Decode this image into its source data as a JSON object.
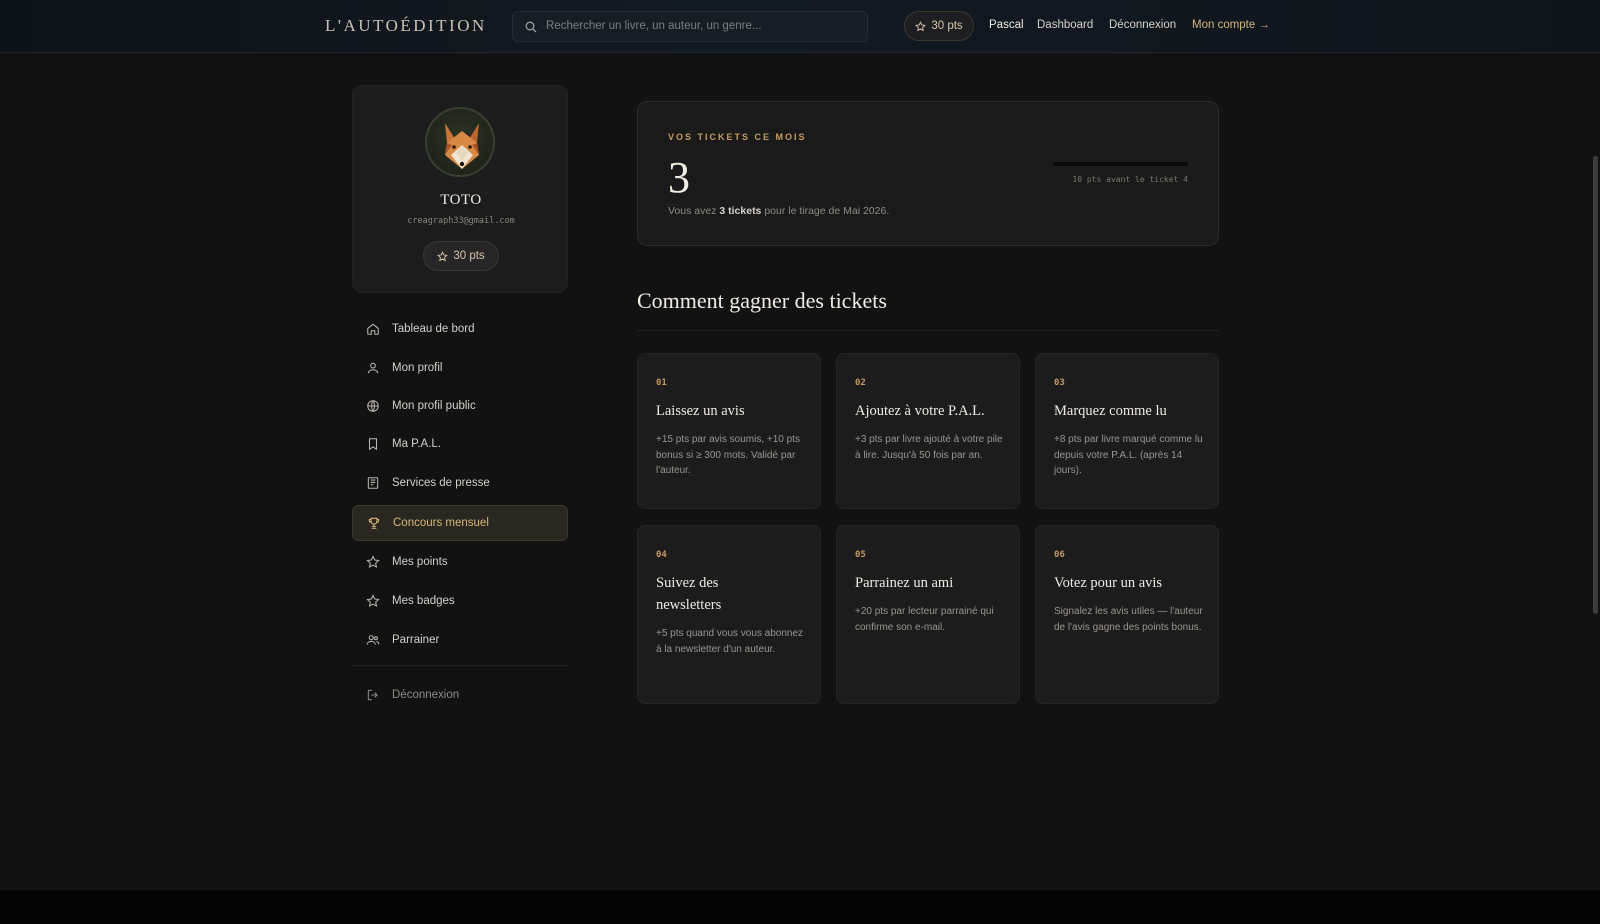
{
  "header": {
    "logo": "L'AUTOÉDITION",
    "search_placeholder": "Rechercher un livre, un auteur, un genre...",
    "points": "30 pts",
    "user": "Pascal",
    "dashboard": "Dashboard",
    "logout": "Déconnexion",
    "account": "Mon compte →"
  },
  "profile": {
    "name": "TOTO",
    "email": "creagraph33@gmail.com",
    "points": "30 pts"
  },
  "sidebar": {
    "items": [
      {
        "label": "Tableau de bord",
        "icon": "home-icon"
      },
      {
        "label": "Mon profil",
        "icon": "user-icon"
      },
      {
        "label": "Mon profil public",
        "icon": "globe-icon"
      },
      {
        "label": "Ma P.A.L.",
        "icon": "bookmark-icon"
      },
      {
        "label": "Services de presse",
        "icon": "newspaper-icon"
      },
      {
        "label": "Concours mensuel",
        "icon": "trophy-icon",
        "active": true
      },
      {
        "label": "Mes points",
        "icon": "star-icon"
      },
      {
        "label": "Mes badges",
        "icon": "star-icon"
      },
      {
        "label": "Parrainer",
        "icon": "users-icon"
      }
    ],
    "logout": "Déconnexion"
  },
  "tickets": {
    "label": "VOS TICKETS CE MOIS",
    "count": "3",
    "desc_prefix": "Vous avez ",
    "desc_bold": "3 tickets",
    "desc_suffix": " pour le tirage de Mai 2026.",
    "next": "10 pts avant le ticket 4",
    "progress": 0
  },
  "how": {
    "title": "Comment gagner des tickets",
    "steps": [
      {
        "num": "01",
        "title": "Laissez un avis",
        "desc": "+15 pts par avis soumis, +10 pts bonus si ≥ 300 mots. Validé par l'auteur."
      },
      {
        "num": "02",
        "title": "Ajoutez à votre P.A.L.",
        "desc": "+3 pts par livre ajouté à votre pile à lire. Jusqu'à 50 fois par an."
      },
      {
        "num": "03",
        "title": "Marquez comme lu",
        "desc": "+8 pts par livre marqué comme lu depuis votre P.A.L. (après 14 jours)."
      },
      {
        "num": "04",
        "title": "Suivez des newsletters",
        "desc": "+5 pts quand vous vous abonnez à la newsletter d'un auteur."
      },
      {
        "num": "05",
        "title": "Parrainez un ami",
        "desc": "+20 pts par lecteur parrainé qui confirme son e-mail."
      },
      {
        "num": "06",
        "title": "Votez pour un avis",
        "desc": "Signalez les avis utiles — l'auteur de l'avis gagne des points bonus."
      }
    ]
  },
  "colors": {
    "accent": "#c49a62",
    "background": "#121212",
    "card": "#1c1c1c"
  }
}
